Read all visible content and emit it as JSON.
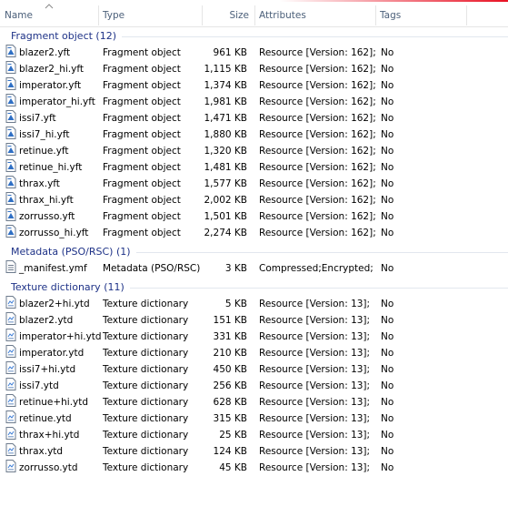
{
  "colors": {
    "accent": "#e81123",
    "group_text": "#1e3287",
    "group_line": "#e2e7ee",
    "header_text": "#4c607a"
  },
  "columns": {
    "name": "Name",
    "type": "Type",
    "size": "Size",
    "attributes": "Attributes",
    "tags": "Tags"
  },
  "groups": [
    {
      "label": "Fragment object (12)",
      "icon": "fragment-file-icon",
      "rows": [
        {
          "name": "blazer2.yft",
          "type": "Fragment object",
          "size": "961 KB",
          "attributes": "Resource [Version: 162];",
          "tags": "No"
        },
        {
          "name": "blazer2_hi.yft",
          "type": "Fragment object",
          "size": "1,115 KB",
          "attributes": "Resource [Version: 162];",
          "tags": "No"
        },
        {
          "name": "imperator.yft",
          "type": "Fragment object",
          "size": "1,374 KB",
          "attributes": "Resource [Version: 162];",
          "tags": "No"
        },
        {
          "name": "imperator_hi.yft",
          "type": "Fragment object",
          "size": "1,981 KB",
          "attributes": "Resource [Version: 162];",
          "tags": "No"
        },
        {
          "name": "issi7.yft",
          "type": "Fragment object",
          "size": "1,471 KB",
          "attributes": "Resource [Version: 162];",
          "tags": "No"
        },
        {
          "name": "issi7_hi.yft",
          "type": "Fragment object",
          "size": "1,880 KB",
          "attributes": "Resource [Version: 162];",
          "tags": "No"
        },
        {
          "name": "retinue.yft",
          "type": "Fragment object",
          "size": "1,320 KB",
          "attributes": "Resource [Version: 162];",
          "tags": "No"
        },
        {
          "name": "retinue_hi.yft",
          "type": "Fragment object",
          "size": "1,481 KB",
          "attributes": "Resource [Version: 162];",
          "tags": "No"
        },
        {
          "name": "thrax.yft",
          "type": "Fragment object",
          "size": "1,577 KB",
          "attributes": "Resource [Version: 162];",
          "tags": "No"
        },
        {
          "name": "thrax_hi.yft",
          "type": "Fragment object",
          "size": "2,002 KB",
          "attributes": "Resource [Version: 162];",
          "tags": "No"
        },
        {
          "name": "zorrusso.yft",
          "type": "Fragment object",
          "size": "1,501 KB",
          "attributes": "Resource [Version: 162];",
          "tags": "No"
        },
        {
          "name": "zorrusso_hi.yft",
          "type": "Fragment object",
          "size": "2,274 KB",
          "attributes": "Resource [Version: 162];",
          "tags": "No"
        }
      ]
    },
    {
      "label": "Metadata (PSO/RSC) (1)",
      "icon": "metadata-file-icon",
      "rows": [
        {
          "name": "_manifest.ymf",
          "type": "Metadata (PSO/RSC)",
          "size": "3 KB",
          "attributes": "Compressed;Encrypted;",
          "tags": "No"
        }
      ]
    },
    {
      "label": "Texture dictionary (11)",
      "icon": "texture-file-icon",
      "rows": [
        {
          "name": "blazer2+hi.ytd",
          "type": "Texture dictionary",
          "size": "5 KB",
          "attributes": "Resource [Version: 13];",
          "tags": "No"
        },
        {
          "name": "blazer2.ytd",
          "type": "Texture dictionary",
          "size": "151 KB",
          "attributes": "Resource [Version: 13];",
          "tags": "No"
        },
        {
          "name": "imperator+hi.ytd",
          "type": "Texture dictionary",
          "size": "331 KB",
          "attributes": "Resource [Version: 13];",
          "tags": "No"
        },
        {
          "name": "imperator.ytd",
          "type": "Texture dictionary",
          "size": "210 KB",
          "attributes": "Resource [Version: 13];",
          "tags": "No"
        },
        {
          "name": "issi7+hi.ytd",
          "type": "Texture dictionary",
          "size": "450 KB",
          "attributes": "Resource [Version: 13];",
          "tags": "No"
        },
        {
          "name": "issi7.ytd",
          "type": "Texture dictionary",
          "size": "256 KB",
          "attributes": "Resource [Version: 13];",
          "tags": "No"
        },
        {
          "name": "retinue+hi.ytd",
          "type": "Texture dictionary",
          "size": "628 KB",
          "attributes": "Resource [Version: 13];",
          "tags": "No"
        },
        {
          "name": "retinue.ytd",
          "type": "Texture dictionary",
          "size": "315 KB",
          "attributes": "Resource [Version: 13];",
          "tags": "No"
        },
        {
          "name": "thrax+hi.ytd",
          "type": "Texture dictionary",
          "size": "25 KB",
          "attributes": "Resource [Version: 13];",
          "tags": "No"
        },
        {
          "name": "thrax.ytd",
          "type": "Texture dictionary",
          "size": "124 KB",
          "attributes": "Resource [Version: 13];",
          "tags": "No"
        },
        {
          "name": "zorrusso.ytd",
          "type": "Texture dictionary",
          "size": "45 KB",
          "attributes": "Resource [Version: 13];",
          "tags": "No"
        }
      ]
    }
  ]
}
